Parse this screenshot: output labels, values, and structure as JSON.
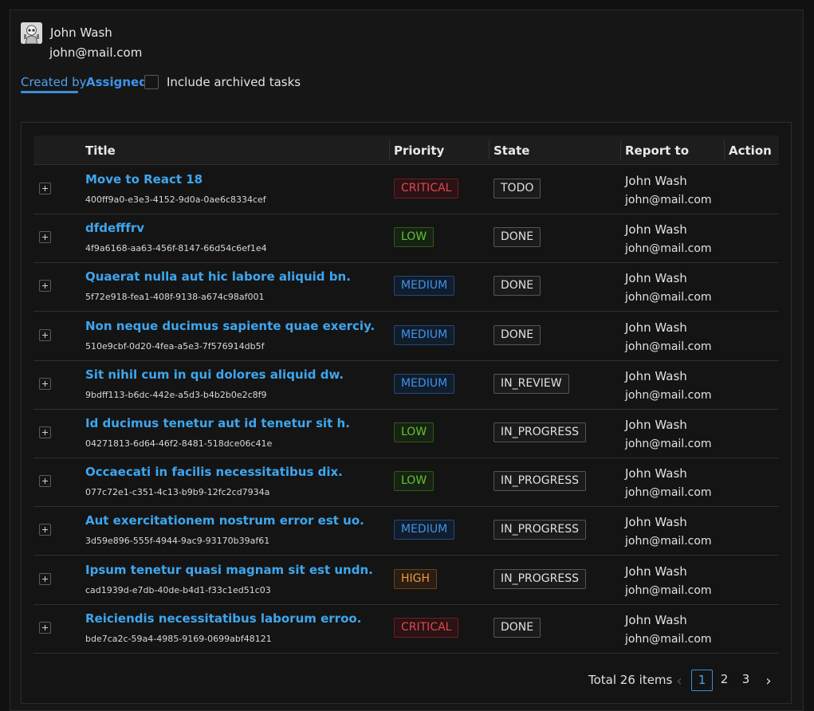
{
  "user": {
    "name": "John Wash",
    "email": "john@mail.com"
  },
  "tabs": {
    "created_by": "Created by",
    "assigned": "Assigned"
  },
  "archived": {
    "label": "Include archived tasks",
    "checked": false
  },
  "table": {
    "headers": {
      "title": "Title",
      "priority": "Priority",
      "state": "State",
      "report_to": "Report to",
      "action": "Action"
    },
    "rows": [
      {
        "title": "Move to React 18",
        "id": "400ff9a0-e3e3-4152-9d0a-0ae6c8334cef",
        "priority": "CRITICAL",
        "state": "TODO",
        "report_name": "John Wash",
        "report_email": "john@mail.com"
      },
      {
        "title": "dfdefffrv",
        "id": "4f9a6168-aa63-456f-8147-66d54c6ef1e4",
        "priority": "LOW",
        "state": "DONE",
        "report_name": "John Wash",
        "report_email": "john@mail.com"
      },
      {
        "title": "Quaerat nulla aut hic labore aliquid bn.",
        "id": "5f72e918-fea1-408f-9138-a674c98af001",
        "priority": "MEDIUM",
        "state": "DONE",
        "report_name": "John Wash",
        "report_email": "john@mail.com"
      },
      {
        "title": "Non neque ducimus sapiente quae exerciy.",
        "id": "510e9cbf-0d20-4fea-a5e3-7f576914db5f",
        "priority": "MEDIUM",
        "state": "DONE",
        "report_name": "John Wash",
        "report_email": "john@mail.com"
      },
      {
        "title": "Sit nihil cum in qui dolores aliquid dw.",
        "id": "9bdff113-b6dc-442e-a5d3-b4b2b0e2c8f9",
        "priority": "MEDIUM",
        "state": "IN_REVIEW",
        "report_name": "John Wash",
        "report_email": "john@mail.com"
      },
      {
        "title": "Id ducimus tenetur aut id tenetur sit h.",
        "id": "04271813-6d64-46f2-8481-518dce06c41e",
        "priority": "LOW",
        "state": "IN_PROGRESS",
        "report_name": "John Wash",
        "report_email": "john@mail.com"
      },
      {
        "title": "Occaecati in facilis necessitatibus dix.",
        "id": "077c72e1-c351-4c13-b9b9-12fc2cd7934a",
        "priority": "LOW",
        "state": "IN_PROGRESS",
        "report_name": "John Wash",
        "report_email": "john@mail.com"
      },
      {
        "title": "Aut exercitationem nostrum error est uo.",
        "id": "3d59e896-555f-4944-9ac9-93170b39af61",
        "priority": "MEDIUM",
        "state": "IN_PROGRESS",
        "report_name": "John Wash",
        "report_email": "john@mail.com"
      },
      {
        "title": "Ipsum tenetur quasi magnam sit est undn.",
        "id": "cad1939d-e7db-40de-b4d1-f33c1ed51c03",
        "priority": "HIGH",
        "state": "IN_PROGRESS",
        "report_name": "John Wash",
        "report_email": "john@mail.com"
      },
      {
        "title": "Reiciendis necessitatibus laborum erroo.",
        "id": "bde7ca2c-59a4-4985-9169-0699abf48121",
        "priority": "CRITICAL",
        "state": "DONE",
        "report_name": "John Wash",
        "report_email": "john@mail.com"
      }
    ]
  },
  "priority_colors": {
    "CRITICAL": {
      "text": "#e0474f",
      "border": "#6b1f24",
      "bg": "#2a1215"
    },
    "LOW": {
      "text": "#62c233",
      "border": "#2e5a1a",
      "bg": "#162312"
    },
    "MEDIUM": {
      "text": "#3e93ea",
      "border": "#1f4a7a",
      "bg": "#111d2c"
    },
    "HIGH": {
      "text": "#e89a3c",
      "border": "#6a4216",
      "bg": "#2b1d11"
    }
  },
  "pagination": {
    "total": "Total 26 items",
    "pages": [
      "1",
      "2",
      "3"
    ],
    "current": "1"
  }
}
